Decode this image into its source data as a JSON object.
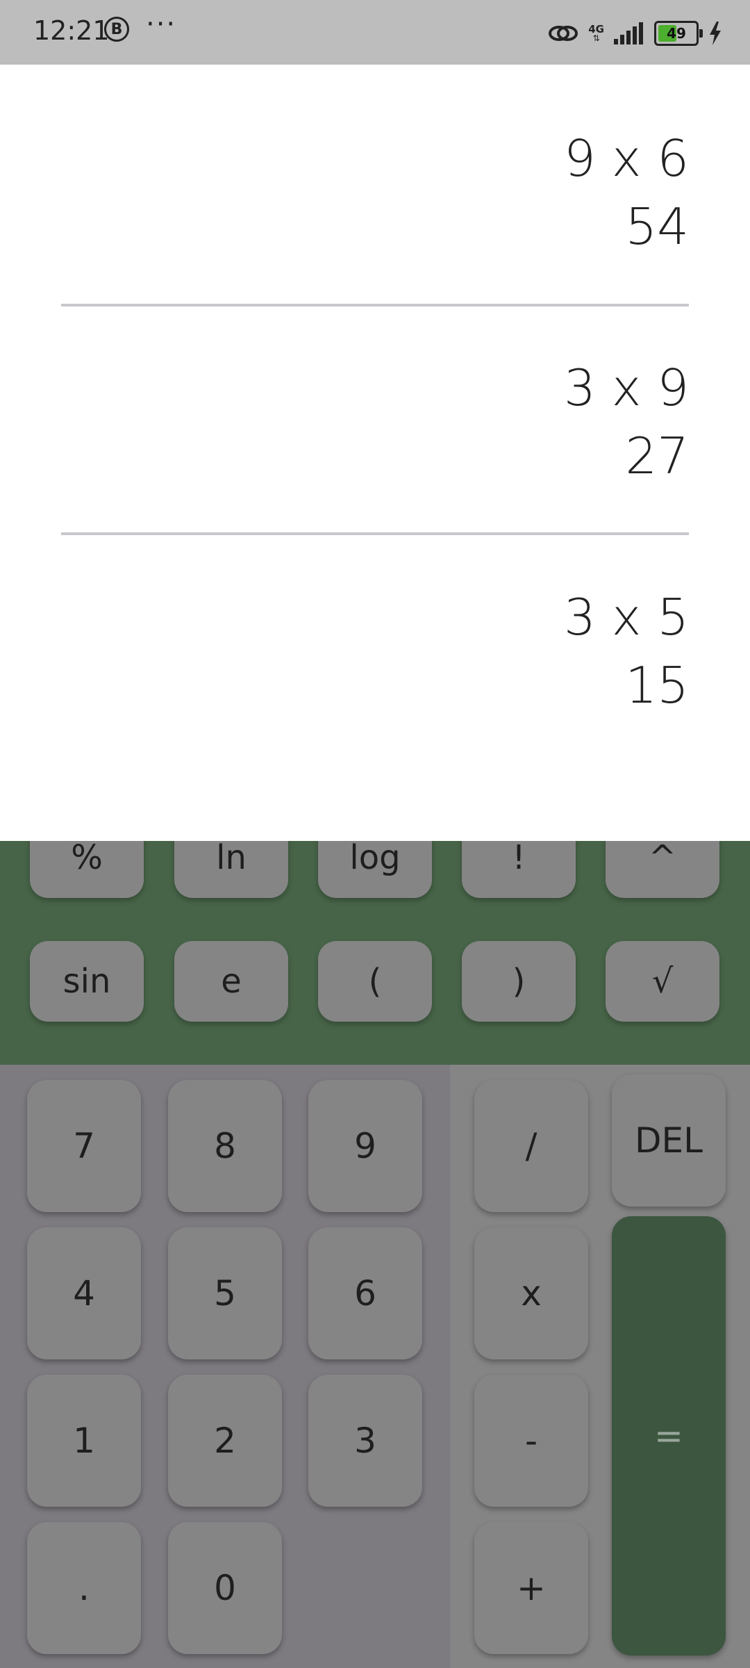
{
  "status_bar": {
    "time": "12:21",
    "badge_letter": "B",
    "more": "···",
    "network": "4G",
    "battery": "49"
  },
  "history": [
    {
      "expression": "9 x 6",
      "result": "54"
    },
    {
      "expression": "3 x 9",
      "result": "27"
    },
    {
      "expression": "3 x 5",
      "result": "15"
    }
  ],
  "scientific_keys": {
    "row1": [
      "%",
      "ln",
      "log",
      "!",
      "^"
    ],
    "row2": [
      "sin",
      "e",
      "(",
      ")",
      "√"
    ]
  },
  "number_keys": {
    "seven": "7",
    "eight": "8",
    "nine": "9",
    "four": "4",
    "five": "5",
    "six": "6",
    "one": "1",
    "two": "2",
    "three": "3",
    "dot": ".",
    "zero": "0"
  },
  "operator_keys": {
    "divide": "/",
    "delete": "DEL",
    "multiply": "x",
    "minus": "-",
    "plus": "+",
    "equals": "="
  },
  "colors": {
    "scientific_panel": "#476448",
    "equals_key": "#3c5640",
    "key": "#858585",
    "numpad_bg": "#7d7a80"
  }
}
